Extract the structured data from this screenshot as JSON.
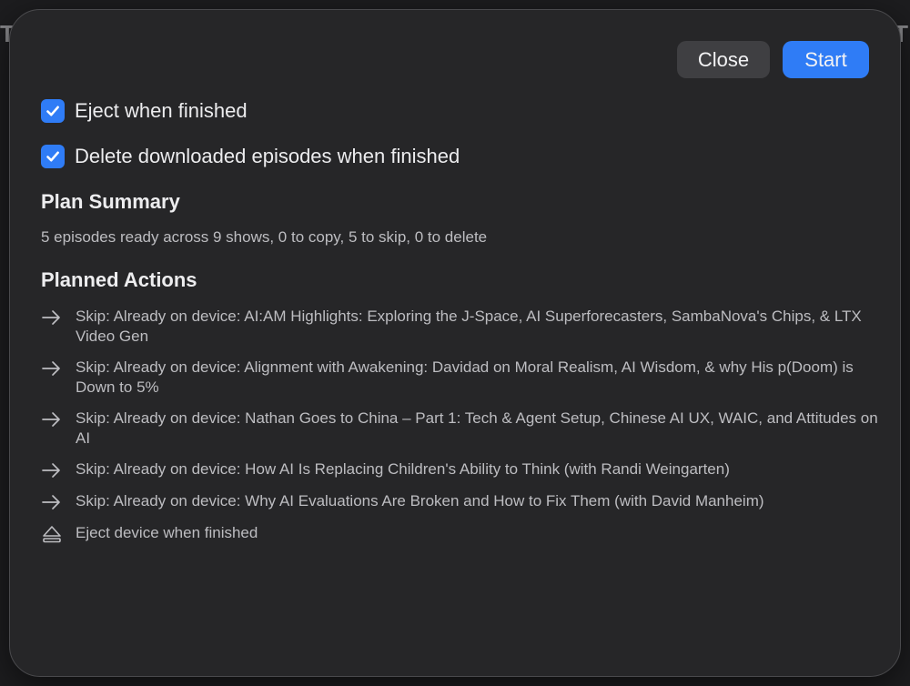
{
  "dialog": {
    "buttons": {
      "close_label": "Close",
      "start_label": "Start"
    },
    "options": [
      {
        "label": "Eject when finished",
        "checked": true
      },
      {
        "label": "Delete downloaded episodes when finished",
        "checked": true
      }
    ],
    "plan_summary": {
      "title": "Plan Summary",
      "text": "5 episodes ready across 9 shows, 0 to copy, 5 to skip, 0 to delete"
    },
    "planned_actions": {
      "title": "Planned Actions",
      "items": [
        {
          "icon": "arrow-right-icon",
          "text": "Skip: Already on device: AI:AM Highlights: Exploring the J-Space, AI Superforecasters, SambaNova's Chips, & LTX Video Gen"
        },
        {
          "icon": "arrow-right-icon",
          "text": "Skip: Already on device: Alignment with Awakening: Davidad on Moral Realism, AI Wisdom, & why His p(Doom) is Down to 5%"
        },
        {
          "icon": "arrow-right-icon",
          "text": "Skip: Already on device: Nathan Goes to China – Part 1: Tech & Agent Setup, Chinese AI UX, WAIC, and Attitudes on AI"
        },
        {
          "icon": "arrow-right-icon",
          "text": "Skip: Already on device: How AI Is Replacing Children's Ability to Think (with Randi Weingarten)"
        },
        {
          "icon": "arrow-right-icon",
          "text": "Skip: Already on device: Why AI Evaluations Are Broken and How to Fix Them (with David Manheim)"
        },
        {
          "icon": "eject-icon",
          "text": "Eject device when finished"
        }
      ]
    }
  },
  "colors": {
    "accent": "#2f7cf6",
    "sheet_background": "#262628",
    "secondary_button": "#3f3f42"
  }
}
